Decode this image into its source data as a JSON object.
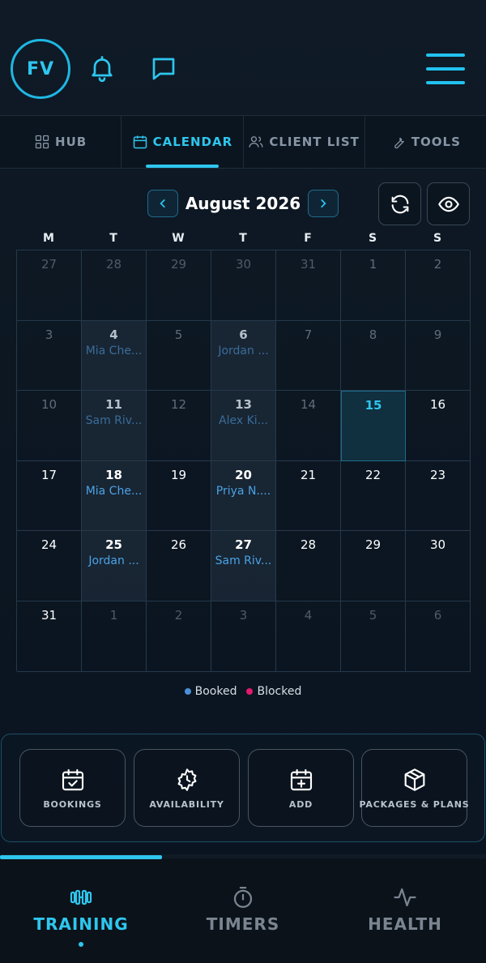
{
  "header": {
    "avatar_initials": "FV",
    "icons": {
      "bell": "bell-icon",
      "chat": "chat-icon",
      "menu": "hamburger-menu-icon"
    }
  },
  "tabs": [
    {
      "label": "HUB",
      "icon": "grid-icon",
      "active": false
    },
    {
      "label": "CALENDAR",
      "icon": "calendar-icon",
      "active": true
    },
    {
      "label": "CLIENT LIST",
      "icon": "users-icon",
      "active": false
    },
    {
      "label": "TOOLS",
      "icon": "wrench-icon",
      "active": false
    }
  ],
  "calendar": {
    "month_label": "August 2026",
    "prev_label": "‹",
    "next_label": "›",
    "weekdays": [
      "M",
      "T",
      "W",
      "T",
      "F",
      "S",
      "S"
    ],
    "weeks": [
      [
        {
          "day": "27",
          "state": "other"
        },
        {
          "day": "28",
          "state": "other"
        },
        {
          "day": "29",
          "state": "other"
        },
        {
          "day": "30",
          "state": "other"
        },
        {
          "day": "31",
          "state": "other"
        },
        {
          "day": "1",
          "state": "past"
        },
        {
          "day": "2",
          "state": "past"
        }
      ],
      [
        {
          "day": "3",
          "state": "past"
        },
        {
          "day": "4",
          "state": "past",
          "client": "Mia Che..."
        },
        {
          "day": "5",
          "state": "past"
        },
        {
          "day": "6",
          "state": "past",
          "client": "Jordan ..."
        },
        {
          "day": "7",
          "state": "past"
        },
        {
          "day": "8",
          "state": "past"
        },
        {
          "day": "9",
          "state": "past"
        }
      ],
      [
        {
          "day": "10",
          "state": "past"
        },
        {
          "day": "11",
          "state": "past",
          "client": "Sam Riv..."
        },
        {
          "day": "12",
          "state": "past"
        },
        {
          "day": "13",
          "state": "past",
          "client": "Alex Ki..."
        },
        {
          "day": "14",
          "state": "past"
        },
        {
          "day": "15",
          "state": "today"
        },
        {
          "day": "16",
          "state": "cur"
        }
      ],
      [
        {
          "day": "17",
          "state": "cur"
        },
        {
          "day": "18",
          "state": "cur",
          "client": "Mia Che..."
        },
        {
          "day": "19",
          "state": "cur"
        },
        {
          "day": "20",
          "state": "cur",
          "client": "Priya N...."
        },
        {
          "day": "21",
          "state": "cur"
        },
        {
          "day": "22",
          "state": "cur"
        },
        {
          "day": "23",
          "state": "cur"
        }
      ],
      [
        {
          "day": "24",
          "state": "cur"
        },
        {
          "day": "25",
          "state": "cur",
          "client": "Jordan ..."
        },
        {
          "day": "26",
          "state": "cur"
        },
        {
          "day": "27",
          "state": "cur",
          "client": "Sam Riv..."
        },
        {
          "day": "28",
          "state": "cur"
        },
        {
          "day": "29",
          "state": "cur"
        },
        {
          "day": "30",
          "state": "cur"
        }
      ],
      [
        {
          "day": "31",
          "state": "cur"
        },
        {
          "day": "1",
          "state": "other"
        },
        {
          "day": "2",
          "state": "other"
        },
        {
          "day": "3",
          "state": "other"
        },
        {
          "day": "4",
          "state": "other"
        },
        {
          "day": "5",
          "state": "other"
        },
        {
          "day": "6",
          "state": "other"
        }
      ]
    ]
  },
  "legend": [
    {
      "label": "Booked",
      "color": "#4a90d9"
    },
    {
      "label": "Blocked",
      "color": "#e5196a"
    }
  ],
  "actions": [
    {
      "label": "BOOKINGS",
      "icon": "calendar-check-icon"
    },
    {
      "label": "AVAILABILITY",
      "icon": "gear-clock-icon"
    },
    {
      "label": "ADD",
      "icon": "calendar-plus-icon"
    },
    {
      "label": "PACKAGES & PLANS",
      "icon": "package-icon"
    }
  ],
  "progress": 0.333,
  "bottom_nav": [
    {
      "label": "TRAINING",
      "icon": "dumbbell-icon",
      "active": true
    },
    {
      "label": "TIMERS",
      "icon": "stopwatch-icon",
      "active": false
    },
    {
      "label": "HEALTH",
      "icon": "pulse-icon",
      "active": false
    }
  ],
  "colors": {
    "accent": "#2ec6ee",
    "booked": "#4a90d9",
    "blocked": "#e5196a"
  }
}
